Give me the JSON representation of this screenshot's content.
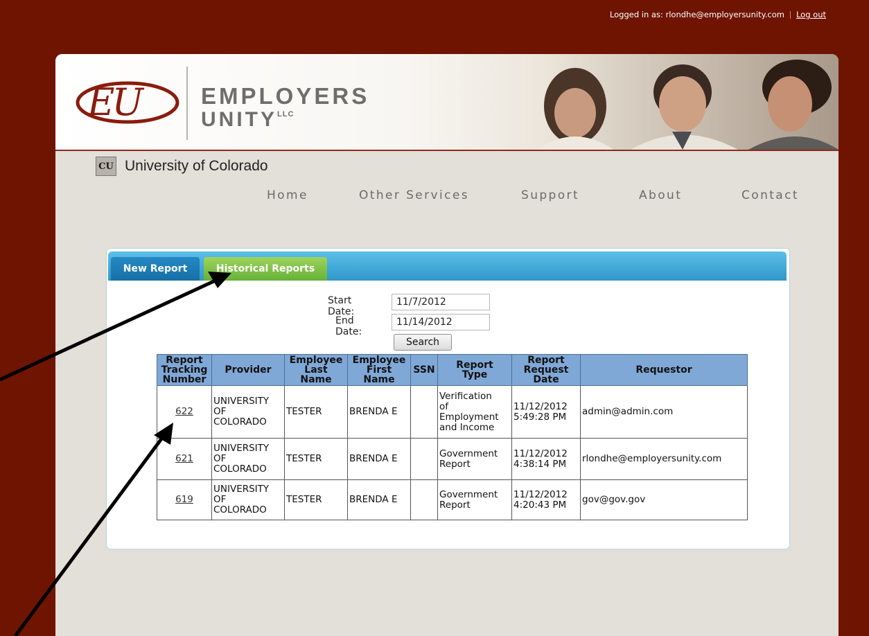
{
  "header": {
    "logged_in_label": "Logged in as: rlondhe@employersunity.com",
    "logout_label": "Log out",
    "company_line1": "EMPLOYERS",
    "company_line2": "UNITY",
    "company_suffix": "LLC",
    "logo_mark": "EU"
  },
  "org": {
    "badge": "CU",
    "name": "University of Colorado"
  },
  "nav": {
    "items": [
      "Home",
      "Other Services",
      "Support",
      "About",
      "Contact"
    ]
  },
  "tabs": {
    "new_report": "New Report",
    "historical_reports": "Historical Reports"
  },
  "search": {
    "start_label": "Start Date:",
    "start_value": "11/7/2012",
    "end_label": "End Date:",
    "end_value": "11/14/2012",
    "button": "Search"
  },
  "table": {
    "headers": {
      "tracking": [
        "Report",
        "Tracking",
        "Number"
      ],
      "provider": "Provider",
      "last": [
        "Employee",
        "Last",
        "Name"
      ],
      "first": [
        "Employee",
        "First",
        "Name"
      ],
      "ssn": "SSN",
      "type": [
        "Report",
        "Type"
      ],
      "date": [
        "Report",
        "Request",
        "Date"
      ],
      "requestor": "Requestor"
    },
    "rows": [
      {
        "number": "622",
        "provider": [
          "UNIVERSITY",
          "OF",
          "COLORADO"
        ],
        "last": "TESTER",
        "first": "BRENDA E",
        "ssn": "",
        "type": [
          "Verification",
          "of",
          "Employment",
          "and Income"
        ],
        "date": [
          "11/12/2012",
          "5:49:28 PM"
        ],
        "requestor": "admin@admin.com"
      },
      {
        "number": "621",
        "provider": [
          "UNIVERSITY",
          "OF",
          "COLORADO"
        ],
        "last": "TESTER",
        "first": "BRENDA E",
        "ssn": "",
        "type": [
          "Government",
          "Report"
        ],
        "date": [
          "11/12/2012",
          "4:38:14 PM"
        ],
        "requestor": "rlondhe@employersunity.com"
      },
      {
        "number": "619",
        "provider": [
          "UNIVERSITY",
          "OF",
          "COLORADO"
        ],
        "last": "TESTER",
        "first": "BRENDA E",
        "ssn": "",
        "type": [
          "Government",
          "Report"
        ],
        "date": [
          "11/12/2012",
          "4:20:43 PM"
        ],
        "requestor": "gov@gov.gov"
      }
    ]
  },
  "colors": {
    "background_frame": "#6f1400",
    "tab_blue": "#2f97c9",
    "tab_green": "#66b238",
    "table_header": "#7fa8d7"
  }
}
